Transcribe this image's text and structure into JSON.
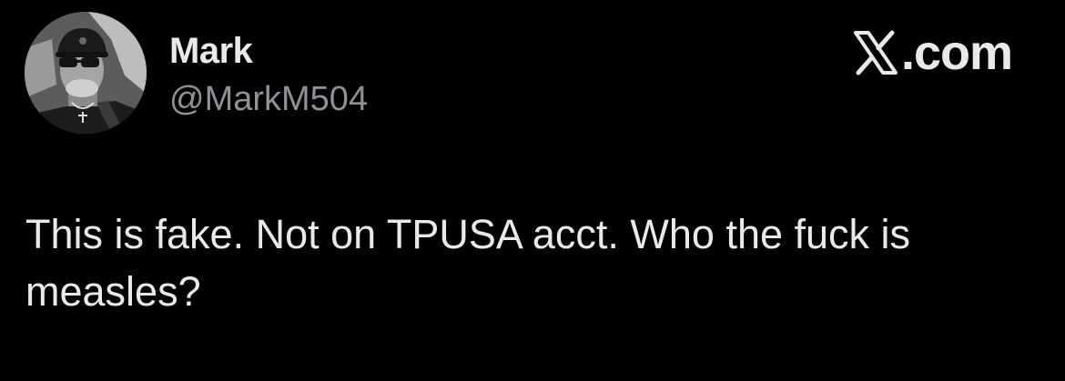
{
  "post": {
    "author": {
      "display_name": "Mark",
      "handle": "@MarkM504",
      "avatar_icon": "user-avatar"
    },
    "source": {
      "brand_text": ".com",
      "brand_icon": "x-logo-icon"
    },
    "text": "This is fake. Not on TPUSA acct. Who the fuck is measles?"
  },
  "colors": {
    "background": "#000000",
    "primary_text": "#e9e9e9",
    "secondary_text": "#8e9196"
  }
}
